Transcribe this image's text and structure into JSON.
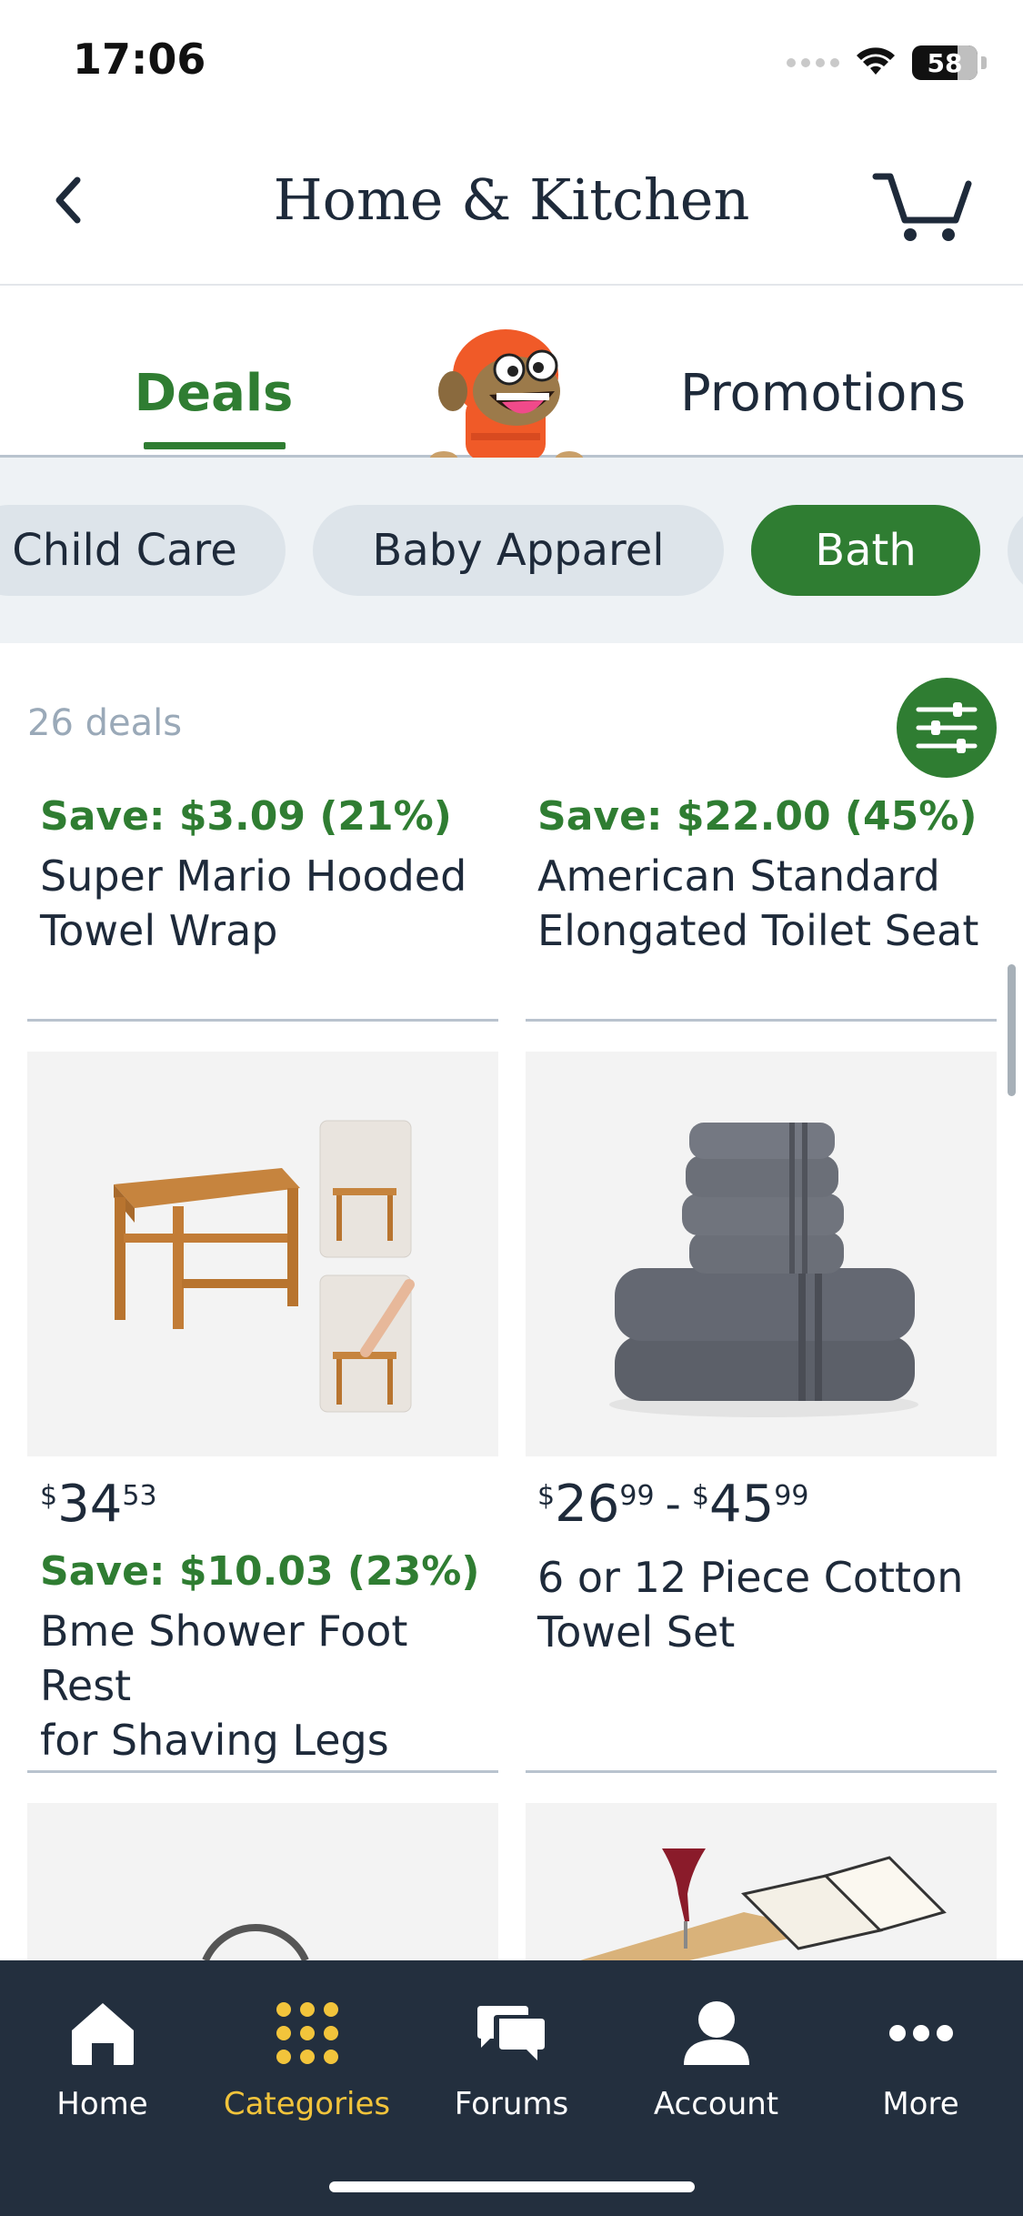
{
  "status_bar": {
    "time": "17:06",
    "battery": "58"
  },
  "header": {
    "title": "Home & Kitchen"
  },
  "tabs": [
    {
      "label": "Deals",
      "active": true
    },
    {
      "label": "Promotions",
      "active": false
    }
  ],
  "chips": [
    {
      "label": "Child Care",
      "active": false
    },
    {
      "label": "Baby Apparel",
      "active": false
    },
    {
      "label": "Bath",
      "active": true
    }
  ],
  "results": {
    "count_text": "26 deals"
  },
  "products": [
    {
      "save": "Save: $3.09 (21%)",
      "name_line1": "Super Mario Hooded",
      "name_line2": "Towel Wrap"
    },
    {
      "save": "Save: $22.00 (45%)",
      "name_line1": "American Standard",
      "name_line2": "Elongated Toilet Seat"
    },
    {
      "price_symbol": "$",
      "price_whole": "34",
      "price_cents": "53",
      "save": "Save: $10.03 (23%)",
      "name_line1": "Bme Shower Foot Rest",
      "name_line2": "for Shaving Legs"
    },
    {
      "price_low_symbol": "$",
      "price_low_whole": "26",
      "price_low_cents": "99",
      "price_separator": "-",
      "price_high_symbol": "$",
      "price_high_whole": "45",
      "price_high_cents": "99",
      "name_line1": "6 or 12 Piece Cotton",
      "name_line2": "Towel Set"
    }
  ],
  "bottom_nav": [
    {
      "label": "Home",
      "icon": "home-icon",
      "active": false
    },
    {
      "label": "Categories",
      "icon": "grid-icon",
      "active": true
    },
    {
      "label": "Forums",
      "icon": "chat-icon",
      "active": false
    },
    {
      "label": "Account",
      "icon": "person-icon",
      "active": false
    },
    {
      "label": "More",
      "icon": "more-icon",
      "active": false
    }
  ],
  "colors": {
    "accent_green": "#2f7d32",
    "nav_bg": "#232f3e",
    "nav_active": "#f2c43b"
  }
}
